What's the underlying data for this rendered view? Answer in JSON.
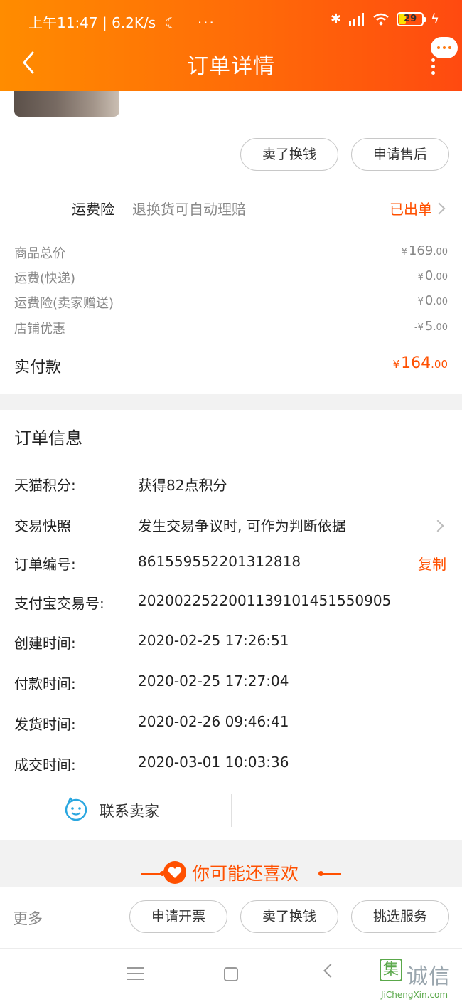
{
  "status_bar": {
    "time_speed": "上午11:47 | 6.2K/s",
    "battery": "29"
  },
  "header": {
    "title": "订单详情"
  },
  "product_actions": {
    "sell_exchange": "卖了换钱",
    "after_sale": "申请售后"
  },
  "insurance": {
    "label": "运费险",
    "description": "退换货可自动理赔",
    "status": "已出单"
  },
  "price_summary": {
    "rows": [
      {
        "label": "商品总价",
        "currency": "¥",
        "int": "169",
        "dec": ".00"
      },
      {
        "label": "运费(快递)",
        "currency": "¥",
        "int": "0",
        "dec": ".00"
      },
      {
        "label": "运费险(卖家赠送)",
        "currency": "¥",
        "int": "0",
        "dec": ".00"
      },
      {
        "label": "店铺优惠",
        "currency": "-¥",
        "int": "5",
        "dec": ".00"
      }
    ],
    "paid": {
      "label": "实付款",
      "currency": "¥",
      "int": "164",
      "dec": ".00"
    }
  },
  "order_info": {
    "title": "订单信息",
    "rows": [
      {
        "label": "天猫积分:",
        "value": "获得82点积分"
      },
      {
        "label": "交易快照",
        "value": "发生交易争议时, 可作为判断依据"
      },
      {
        "label": "订单编号:",
        "value": "861559552201312818",
        "action": "复制"
      },
      {
        "label": "支付宝交易号:",
        "value": "2020022522001139101451550905"
      },
      {
        "label": "创建时间:",
        "value": "2020-02-25 17:26:51"
      },
      {
        "label": "付款时间:",
        "value": "2020-02-25 17:27:04"
      },
      {
        "label": "发货时间:",
        "value": "2020-02-26 09:46:41"
      },
      {
        "label": "成交时间:",
        "value": "2020-03-01 10:03:36"
      }
    ],
    "contact_seller": "联系卖家"
  },
  "recommend": {
    "title": "你可能还喜欢"
  },
  "bottom_bar": {
    "more": "更多",
    "invoice": "申请开票",
    "sell_exchange": "卖了换钱",
    "pick_service": "挑选服务"
  },
  "watermark": {
    "char": "集",
    "text": "诚信",
    "url": "JiChengXin.com"
  },
  "colors": {
    "accent": "#ff5000",
    "header_start": "#ff8c00",
    "header_end": "#ff4a10"
  }
}
